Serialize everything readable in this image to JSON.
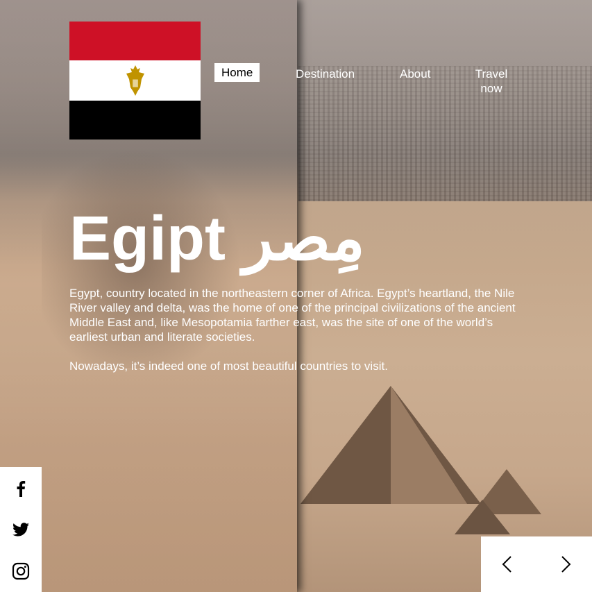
{
  "nav": {
    "home": "Home",
    "destination": "Destination",
    "about": "About",
    "travel": "Travel now"
  },
  "hero": {
    "title": "Egipt مِصر",
    "paragraph1": "Egypt, country located in the northeastern corner of Africa. Egypt’s heartland, the Nile River valley and delta, was the home of one of the principal civilizations of the ancient Middle East and, like Mesopotamia farther east, was the site of one of the world’s earliest urban and literate societies.",
    "paragraph2": "Nowadays, it’s indeed one of most beautiful countries to visit."
  },
  "flag": {
    "colors": [
      "#ce1126",
      "#ffffff",
      "#000000"
    ],
    "emblem": "eagle-of-saladin"
  },
  "social": [
    "facebook-icon",
    "twitter-icon",
    "instagram-icon"
  ],
  "controls": [
    "prev-arrow-icon",
    "next-arrow-icon"
  ]
}
